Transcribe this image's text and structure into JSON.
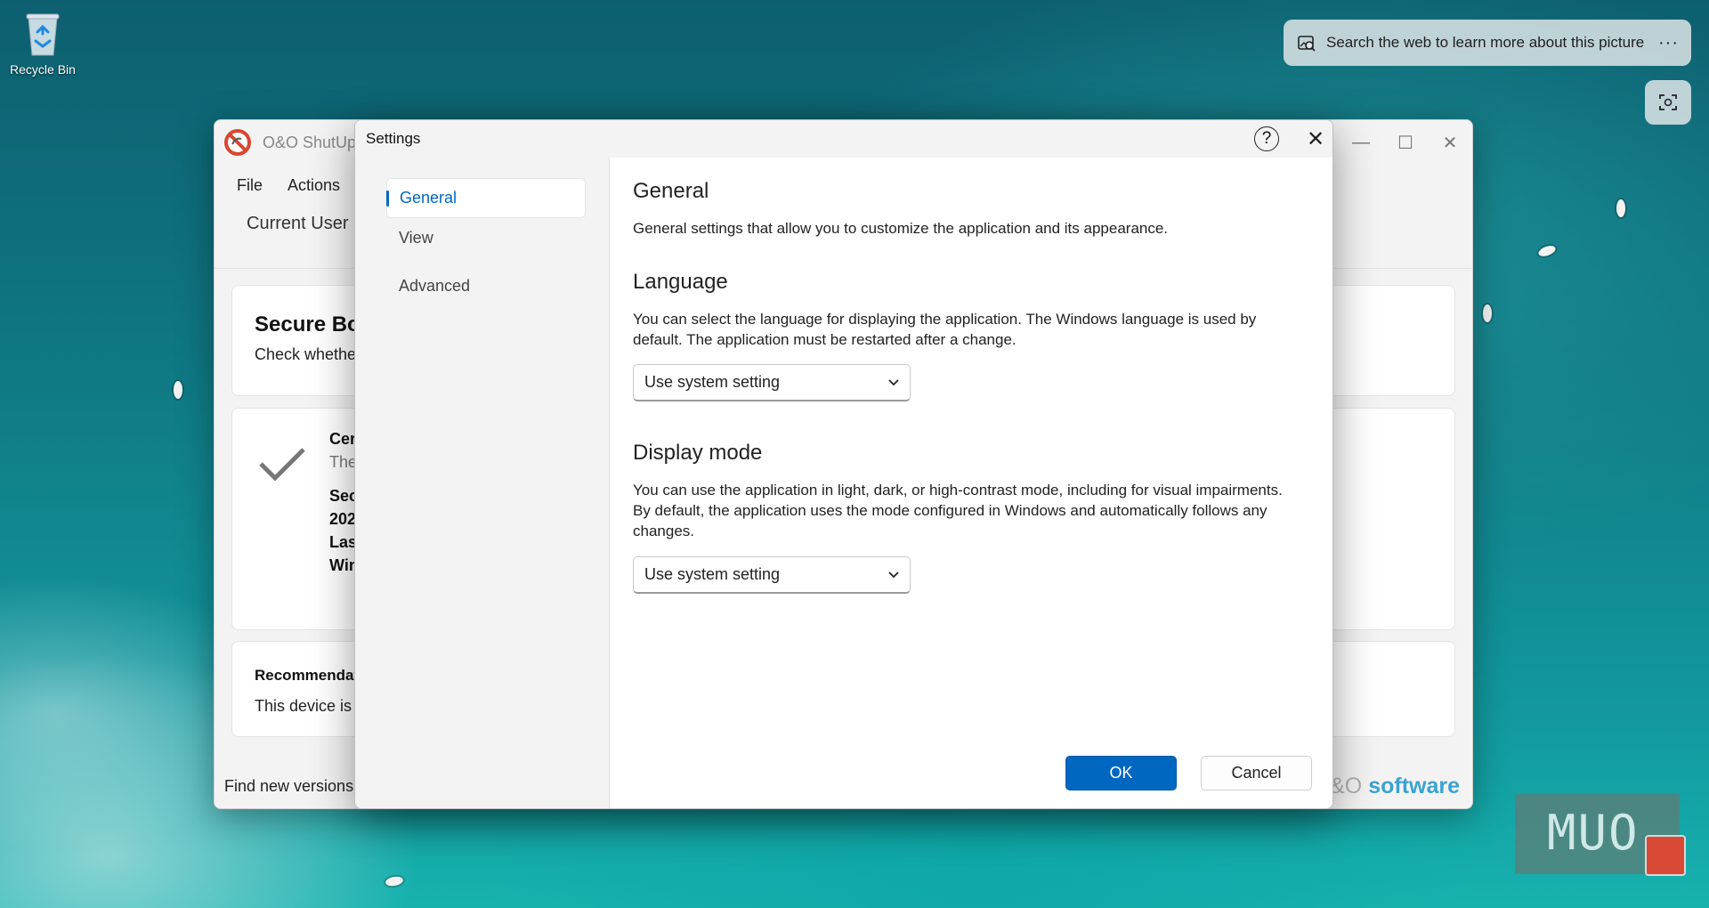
{
  "desktop": {
    "recycle_bin_label": "Recycle Bin",
    "lens_bar_text": "Search the web to learn more about this picture",
    "lens_more": "···",
    "watermark": "MUO"
  },
  "app": {
    "title": "O&O ShutUp",
    "menu": {
      "file": "File",
      "actions": "Actions"
    },
    "tab": "Current User",
    "card1": {
      "title": "Secure Bo",
      "subtitle": "Check whether"
    },
    "card2": {
      "line1": "Cer",
      "line2": "The",
      "line3": "Sec",
      "line4": "202",
      "line5": "Last",
      "line6": "Win"
    },
    "card3": {
      "title": "Recommendat",
      "subtitle": "This device is p"
    },
    "footer": "Find new versions a",
    "brand_prefix": "O&O",
    "brand_name": "software"
  },
  "dialog": {
    "title": "Settings",
    "help_label": "?",
    "close_label": "✕",
    "nav": [
      {
        "label": "General",
        "active": true
      },
      {
        "label": "View",
        "active": false
      },
      {
        "label": "Advanced",
        "active": false
      }
    ],
    "general": {
      "title": "General",
      "description": "General settings that allow you to customize the application and its appearance."
    },
    "language": {
      "title": "Language",
      "description": "You can select the language for displaying the application. The Windows language is used by default. The application must be restarted after a change.",
      "value": "Use system setting"
    },
    "display_mode": {
      "title": "Display mode",
      "description": "You can use the application in light, dark, or high-contrast mode, including for visual impairments. By default, the application uses the mode configured in Windows and automatically follows any changes.",
      "value": "Use system setting"
    },
    "ok_label": "OK",
    "cancel_label": "Cancel"
  },
  "colors": {
    "accent": "#0067c0",
    "brand_blue": "#3ba3d2"
  }
}
